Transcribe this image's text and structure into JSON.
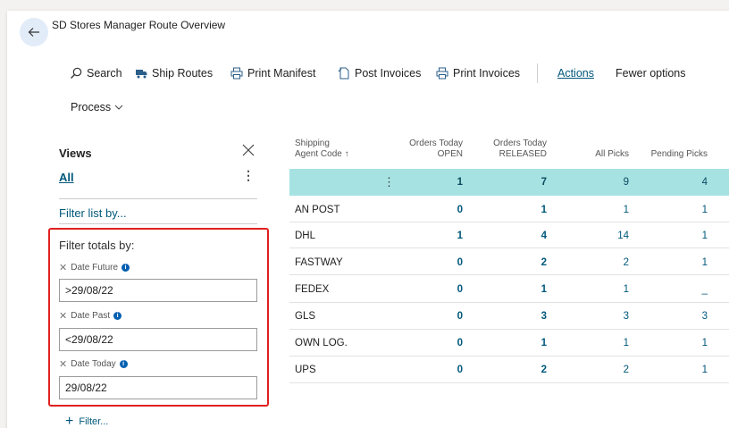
{
  "page": {
    "title": "SD Stores Manager Route Overview"
  },
  "actions": {
    "search": "Search",
    "ship_routes": "Ship Routes",
    "print_manifest": "Print Manifest",
    "post_invoices": "Post Invoices",
    "print_invoices": "Print Invoices",
    "actions": "Actions",
    "fewer_options": "Fewer options",
    "process": "Process"
  },
  "views": {
    "title": "Views",
    "all": "All",
    "more": "⋮",
    "filter_list": "Filter list by...",
    "filter_totals": "Filter totals by:",
    "filters": [
      {
        "label": "Date Future",
        "value": ">29/08/22"
      },
      {
        "label": "Date Past",
        "value": "<29/08/22"
      },
      {
        "label": "Date Today",
        "value": "29/08/22"
      }
    ],
    "add_filter": "Filter..."
  },
  "grid": {
    "headers": {
      "code_line1": "Shipping",
      "code_line2": "Agent Code ↑",
      "open_line1": "Orders Today",
      "open_line2": "OPEN",
      "released_line1": "Orders Today",
      "released_line2": "RELEASED",
      "all_picks": "All Picks",
      "pending_picks": "Pending Picks"
    },
    "selected_row": {
      "code": "",
      "open": "1",
      "released": "7",
      "all": "9",
      "pending": "4"
    },
    "rows": [
      {
        "code": "AN POST",
        "open": "0",
        "released": "1",
        "all": "1",
        "pending": "1"
      },
      {
        "code": "DHL",
        "open": "1",
        "released": "4",
        "all": "14",
        "pending": "1"
      },
      {
        "code": "FASTWAY",
        "open": "0",
        "released": "2",
        "all": "2",
        "pending": "1"
      },
      {
        "code": "FEDEX",
        "open": "0",
        "released": "1",
        "all": "1",
        "pending": "_"
      },
      {
        "code": "GLS",
        "open": "0",
        "released": "3",
        "all": "3",
        "pending": "3"
      },
      {
        "code": "OWN LOG.",
        "open": "0",
        "released": "1",
        "all": "1",
        "pending": "1"
      },
      {
        "code": "UPS",
        "open": "0",
        "released": "2",
        "all": "2",
        "pending": "1"
      }
    ]
  },
  "colors": {
    "accent": "#00587b",
    "selected_row": "#a7e2e3",
    "highlight_box": "#e0201f"
  }
}
